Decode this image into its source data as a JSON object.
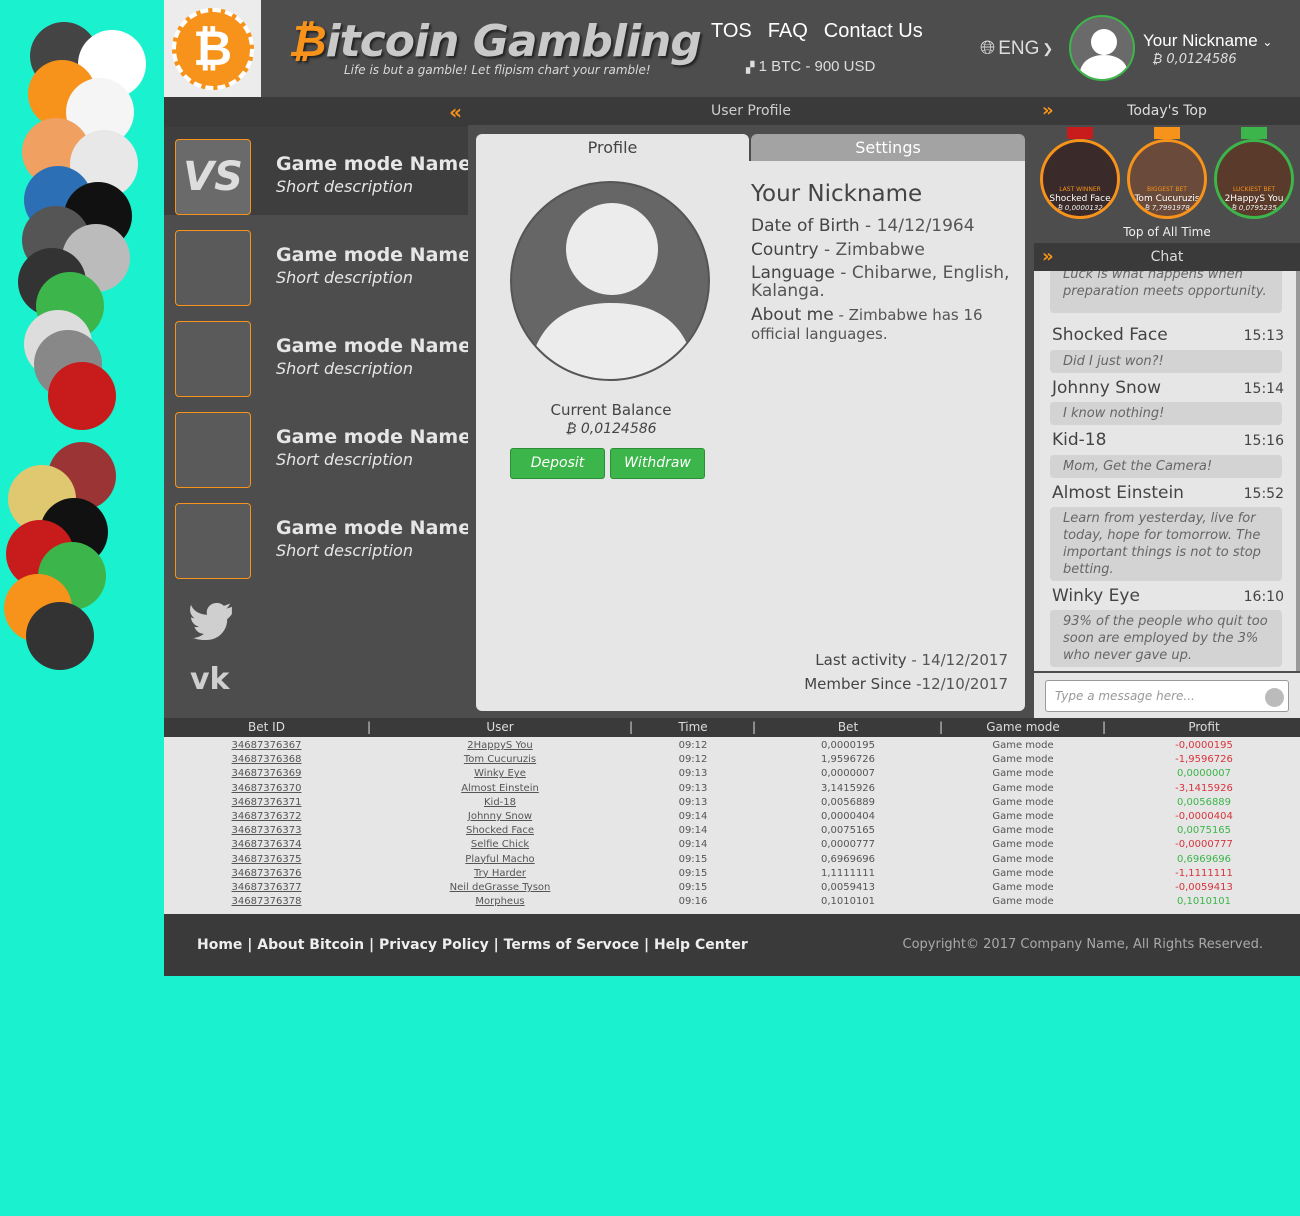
{
  "header": {
    "brand_symbol": "₿",
    "brand_rest": "itcoin Gambling",
    "slogan": "Life is but a gamble! Let flipism chart your ramble!",
    "nav": [
      "TOS",
      "FAQ",
      "Contact Us"
    ],
    "rate": "1 BTC - 900 USD",
    "language": "ENG",
    "user_name": "Your Nickname",
    "user_balance": "₿ 0,0124586"
  },
  "sidebar": {
    "games": [
      {
        "name": "Game mode Name",
        "desc": "Short description",
        "thumb": "VS"
      },
      {
        "name": "Game mode Name",
        "desc": "Short description",
        "thumb": ""
      },
      {
        "name": "Game mode Name",
        "desc": "Short description",
        "thumb": ""
      },
      {
        "name": "Game mode Name",
        "desc": "Short description",
        "thumb": ""
      },
      {
        "name": "Game mode Name",
        "desc": "Short description",
        "thumb": ""
      }
    ],
    "social": [
      "twitter-icon",
      "vk-icon"
    ]
  },
  "main": {
    "title": "User Profile",
    "tabs": {
      "profile": "Profile",
      "settings": "Settings"
    },
    "balance_label": "Current Balance",
    "balance_value": "₿ 0,0124586",
    "deposit": "Deposit",
    "withdraw": "Withdraw",
    "nickname": "Your Nickname",
    "dob_label": "Date of Birth",
    "dob_value": " - 14/12/1964",
    "country_label": "Country",
    "country_value": " - Zimbabwe",
    "language_label": "Language",
    "language_value": " - Chibarwe, English, Kalanga.",
    "about_label": "About me",
    "about_value": " - Zimbabwe has 16 official languages.",
    "last_activity_label": "Last activity",
    "last_activity_value": " - 14/12/2017",
    "member_since_label": "Member Since",
    "member_since_value": " -12/10/2017"
  },
  "right": {
    "top_title": "Today's Top",
    "winners": [
      {
        "tag": "LAST WINNER",
        "name": "Shocked Face",
        "amount": "₿ 0,0000132"
      },
      {
        "tag": "BIGGEST BET",
        "name": "Tom Cucuruzis",
        "amount": "₿ 7,7991978"
      },
      {
        "tag": "LUCKIEST BET",
        "name": "2HappyS You",
        "amount": "₿ 0,0795235"
      }
    ],
    "top_all": "Top of All Time",
    "chat_title": "Chat",
    "chat": [
      {
        "user": "",
        "time": "",
        "msg": "Luck is what happens when preparation meets opportunity."
      },
      {
        "user": "Shocked Face",
        "time": "15:13",
        "msg": "Did I just won?!"
      },
      {
        "user": "Johnny Snow",
        "time": "15:14",
        "msg": "I know nothing!"
      },
      {
        "user": "Kid-18",
        "time": "15:16",
        "msg": "Mom, Get the Camera!"
      },
      {
        "user": "Almost Einstein",
        "time": "15:52",
        "msg": "Learn from yesterday, live for today, hope for tomorrow. The important things is not to stop betting."
      },
      {
        "user": "Winky Eye",
        "time": "16:10",
        "msg": "93% of the people who quit too soon are employed by the 3% who never gave up."
      }
    ],
    "chat_placeholder": "Type a message here..."
  },
  "table": {
    "headers": [
      "Bet ID",
      "User",
      "Time",
      "Bet",
      "Game mode",
      "Profit"
    ],
    "rows": [
      [
        "34687376367",
        "2HappyS You",
        "09:12",
        "0,0000195",
        "Game mode",
        "-0,0000195"
      ],
      [
        "34687376368",
        "Tom Cucuruzis",
        "09:12",
        "1,9596726",
        "Game mode",
        "-1,9596726"
      ],
      [
        "34687376369",
        "Winky Eye",
        "09:13",
        "0,0000007",
        "Game mode",
        "0,0000007"
      ],
      [
        "34687376370",
        "Almost Einstein",
        "09:13",
        "3,1415926",
        "Game mode",
        "-3,1415926"
      ],
      [
        "34687376371",
        "Kid-18",
        "09:13",
        "0,0056889",
        "Game mode",
        "0,0056889"
      ],
      [
        "34687376372",
        "Johnny Snow",
        "09:14",
        "0,0000404",
        "Game mode",
        "-0,0000404"
      ],
      [
        "34687376373",
        "Shocked Face",
        "09:14",
        "0,0075165",
        "Game mode",
        "0,0075165"
      ],
      [
        "34687376374",
        "Selfie Chick",
        "09:14",
        "0,0000777",
        "Game mode",
        "-0,0000777"
      ],
      [
        "34687376375",
        "Playful Macho",
        "09:15",
        "0,6969696",
        "Game mode",
        "0,6969696"
      ],
      [
        "34687376376",
        "Try Harder",
        "09:15",
        "1,1111111",
        "Game mode",
        "-1,1111111"
      ],
      [
        "34687376377",
        "Neil deGrasse Tyson",
        "09:15",
        "0,0059413",
        "Game mode",
        "-0,0059413"
      ],
      [
        "34687376378",
        "Morpheus",
        "09:16",
        "0,1010101",
        "Game mode",
        "0,1010101"
      ]
    ]
  },
  "footer": {
    "links": [
      "Home",
      "About Bitcoin",
      "Privacy Policy",
      "Terms of Servoce",
      "Help Center"
    ],
    "copyright": "Copyright© 2017 Company Name, All Rights Reserved."
  }
}
